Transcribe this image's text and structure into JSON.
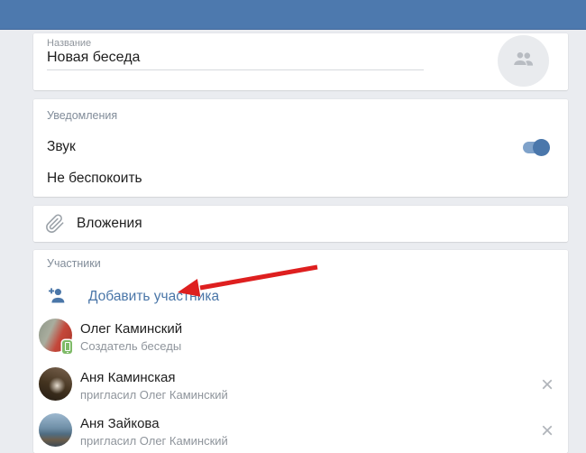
{
  "name_card": {
    "label": "Название",
    "value": "Новая беседа"
  },
  "notifications": {
    "title": "Уведомления",
    "sound_label": "Звук",
    "sound_enabled": true,
    "dnd_label": "Не беспокоить"
  },
  "attachments": {
    "label": "Вложения",
    "icon": "paperclip-icon"
  },
  "participants": {
    "title": "Участники",
    "add_label": "Добавить участника",
    "add_icon": "person-add-icon",
    "remove_symbol": "×",
    "items": [
      {
        "name": "Олег Каминский",
        "subtitle": "Создатель беседы",
        "removable": false,
        "online_mobile": true
      },
      {
        "name": "Аня Каминская",
        "subtitle": "пригласил Олег Каминский",
        "removable": true
      },
      {
        "name": "Аня Зайкова",
        "subtitle": "пригласил Олег Каминский",
        "removable": true
      }
    ]
  },
  "annotation": {
    "type": "red-arrow",
    "points_at": "Добавить участника",
    "color": "#de1f1f"
  },
  "colors": {
    "header_blue": "#4d79ae",
    "page_background": "#eaecf0",
    "accent_blue": "#4a76a8",
    "toggle_track": "#7fa2ca",
    "toggle_knob": "#4a77ab",
    "online_badge_green": "#7eba67"
  }
}
